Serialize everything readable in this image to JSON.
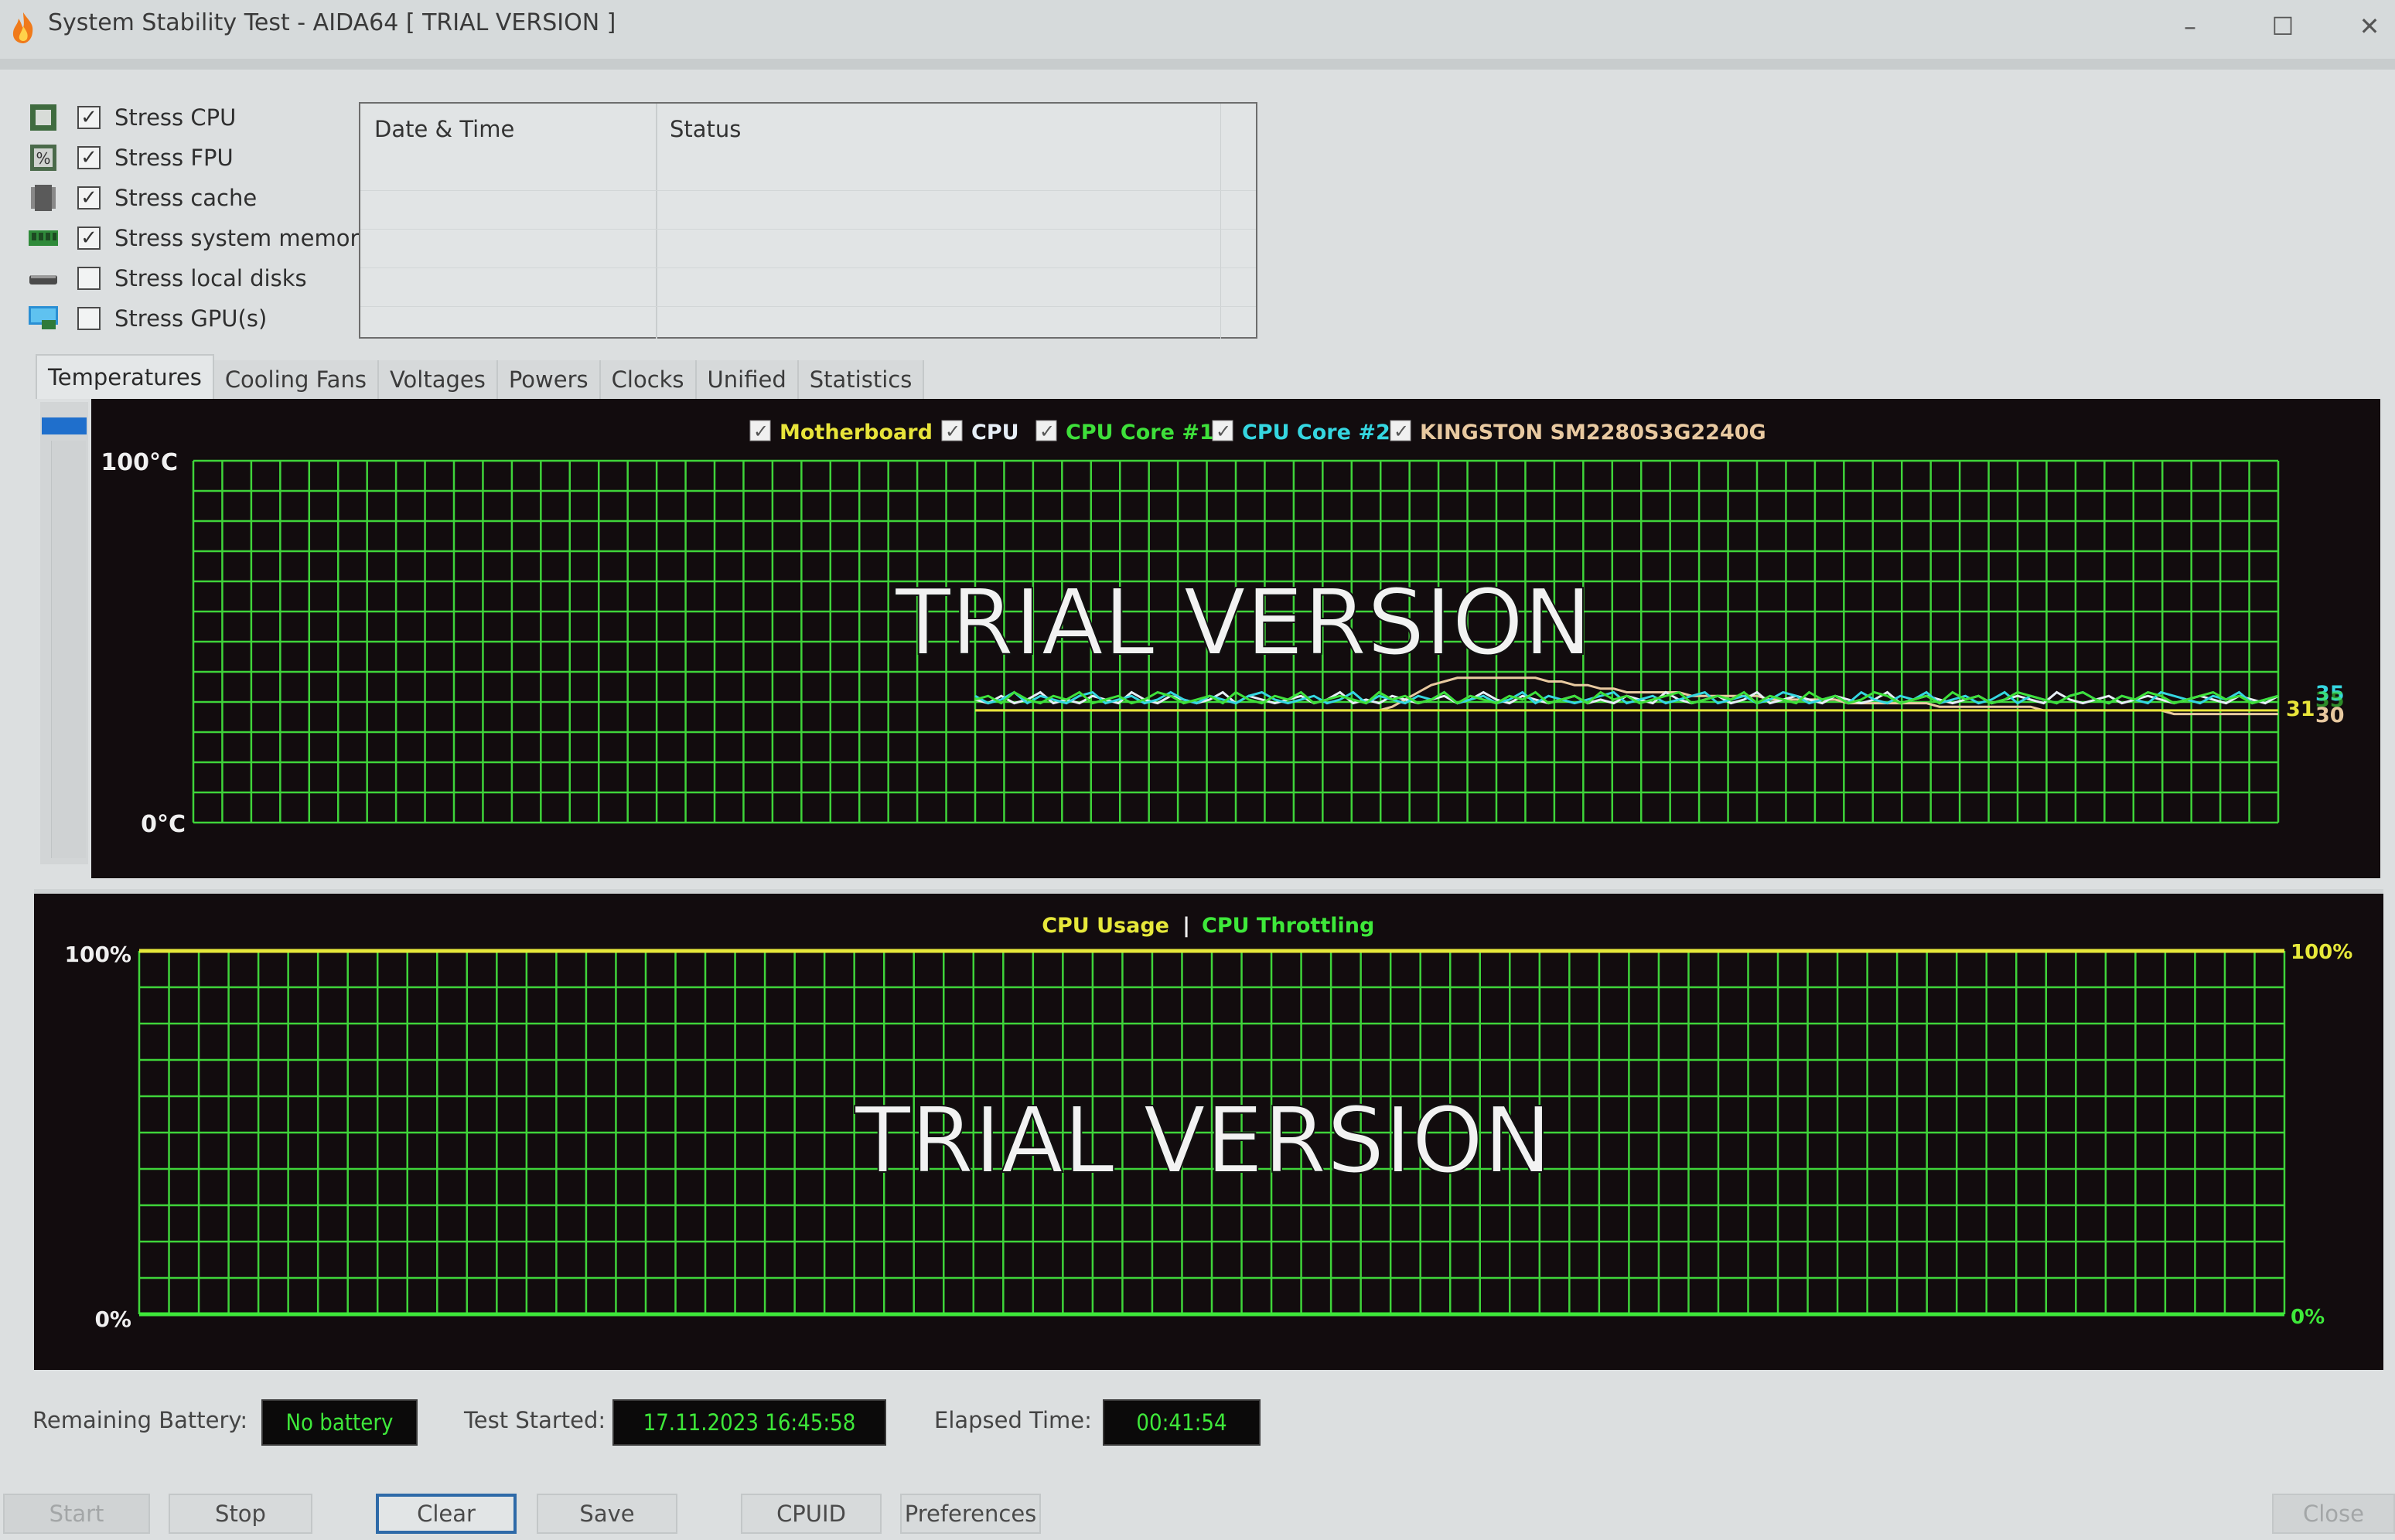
{
  "window": {
    "title": "System Stability Test - AIDA64  [ TRIAL VERSION ]",
    "app_icon": "flame-icon",
    "controls": {
      "minimize": "–",
      "maximize": "☐",
      "close": "✕"
    }
  },
  "stress_options": [
    {
      "label": "Stress CPU",
      "checked": true,
      "icon": "cpu-chip-icon"
    },
    {
      "label": "Stress FPU",
      "checked": true,
      "icon": "fpu-percent-icon"
    },
    {
      "label": "Stress cache",
      "checked": true,
      "icon": "cache-chip-icon"
    },
    {
      "label": "Stress system memory",
      "checked": true,
      "icon": "memory-module-icon"
    },
    {
      "label": "Stress local disks",
      "checked": false,
      "icon": "disk-drive-icon"
    },
    {
      "label": "Stress GPU(s)",
      "checked": false,
      "icon": "gpu-monitor-icon"
    }
  ],
  "status_table": {
    "columns": [
      "Date & Time",
      "Status"
    ],
    "rows": []
  },
  "tabs": [
    {
      "label": "Temperatures",
      "active": true
    },
    {
      "label": "Cooling Fans",
      "active": false
    },
    {
      "label": "Voltages",
      "active": false
    },
    {
      "label": "Powers",
      "active": false
    },
    {
      "label": "Clocks",
      "active": false
    },
    {
      "label": "Unified",
      "active": false
    },
    {
      "label": "Statistics",
      "active": false
    }
  ],
  "watermark": "TRIAL VERSION",
  "colors": {
    "grid": "#3fd43a",
    "motherboard": "#e8e43a",
    "cpu": "#e6eef6",
    "core1": "#3ee03a",
    "core2": "#35d6e0",
    "kingston": "#e8c9a0",
    "usage": "#e6e83a",
    "throttling": "#3ee83a"
  },
  "chart_data": [
    {
      "type": "line",
      "title": "Temperatures",
      "ylabel": "°C",
      "ylim": [
        0,
        100
      ],
      "y_tick_labels": [
        "100°C",
        "0°C"
      ],
      "grid": true,
      "legend_position": "top-center",
      "x": [
        0,
        1,
        2,
        3,
        4,
        5,
        6,
        7,
        8,
        9,
        10,
        11,
        12,
        13,
        14,
        15,
        16,
        17,
        18,
        19,
        20,
        21,
        22,
        23,
        24,
        25,
        26,
        27,
        28,
        29,
        30,
        31,
        32,
        33,
        34,
        35,
        36,
        37,
        38,
        39,
        40,
        41,
        42,
        43,
        44,
        45,
        46,
        47,
        48,
        49,
        50,
        51,
        52,
        53,
        54,
        55,
        56,
        57,
        58,
        59,
        60,
        61,
        62,
        63,
        64,
        65,
        66,
        67,
        68,
        69,
        70,
        71,
        72,
        73,
        74,
        75,
        76,
        77,
        78,
        79,
        80,
        81,
        82,
        83,
        84,
        85,
        86,
        87,
        88,
        89,
        90,
        91,
        92,
        93,
        94,
        95,
        96,
        97,
        98,
        99,
        100
      ],
      "x_start_fraction": 0.375,
      "series": [
        {
          "name": "Motherboard",
          "checked": true,
          "color": "#e8e43a",
          "current": 31,
          "values": [
            31,
            31,
            31,
            31,
            31,
            31,
            31,
            31,
            31,
            31,
            31,
            31,
            31,
            31,
            31,
            31,
            31,
            31,
            31,
            31,
            31,
            31,
            31,
            31,
            31,
            31,
            31,
            31,
            31,
            31,
            31,
            31,
            31,
            31,
            31,
            31,
            31,
            31,
            31,
            31,
            31,
            31,
            31,
            31,
            31,
            31,
            31,
            31,
            31,
            31,
            31,
            31,
            31,
            31,
            31,
            31,
            31,
            31,
            31,
            31,
            31,
            31,
            31,
            31,
            31,
            31,
            31,
            31,
            31,
            31,
            31,
            31,
            31,
            31,
            31,
            31,
            31,
            31,
            31,
            31,
            31,
            31,
            31,
            31,
            31,
            31,
            31,
            31,
            31,
            31,
            31,
            31,
            31,
            31,
            31,
            31,
            31,
            31,
            31,
            31,
            31
          ]
        },
        {
          "name": "CPU",
          "checked": true,
          "color": "#e6eef6",
          "current": null,
          "values": [
            34,
            33,
            35,
            33,
            34,
            36,
            33,
            34,
            33,
            35,
            34,
            33,
            36,
            34,
            33,
            35,
            34,
            33,
            34,
            36,
            33,
            35,
            34,
            33,
            34,
            35,
            33,
            34,
            36,
            33,
            34,
            33,
            35,
            34,
            33,
            34,
            35,
            33,
            34,
            36,
            34,
            33,
            35,
            34,
            33,
            34,
            35,
            33,
            34,
            33,
            35,
            34,
            33,
            36,
            34,
            33,
            34,
            35,
            33,
            34,
            36,
            33,
            34,
            35,
            34,
            33,
            35,
            34,
            33,
            34,
            36,
            33,
            34,
            35,
            34,
            33,
            34,
            35,
            33,
            34,
            35,
            34,
            33,
            36,
            34,
            33,
            34,
            35,
            33,
            34,
            35,
            34,
            33,
            34,
            35,
            34,
            33,
            35,
            34,
            33,
            35
          ]
        },
        {
          "name": "CPU Core #1",
          "checked": true,
          "color": "#3ee03a",
          "current": 35,
          "values": [
            34,
            35,
            33,
            36,
            34,
            33,
            35,
            34,
            36,
            33,
            34,
            35,
            33,
            34,
            36,
            35,
            33,
            34,
            35,
            33,
            36,
            34,
            33,
            35,
            34,
            36,
            33,
            34,
            35,
            34,
            33,
            36,
            34,
            35,
            33,
            34,
            36,
            33,
            35,
            34,
            33,
            35,
            34,
            36,
            33,
            34,
            35,
            33,
            36,
            34,
            35,
            33,
            34,
            35,
            36,
            33,
            34,
            35,
            34,
            36,
            33,
            35,
            34,
            33,
            36,
            34,
            35,
            33,
            34,
            36,
            35,
            33,
            34,
            35,
            33,
            36,
            34,
            35,
            33,
            34,
            36,
            35,
            34,
            33,
            35,
            36,
            34,
            33,
            35,
            34,
            36,
            35,
            33,
            34,
            35,
            36,
            34,
            35,
            33,
            34,
            35
          ]
        },
        {
          "name": "CPU Core #2",
          "checked": true,
          "color": "#35d6e0",
          "current": 35,
          "values": [
            35,
            33,
            34,
            36,
            33,
            35,
            34,
            33,
            35,
            36,
            33,
            34,
            35,
            33,
            34,
            36,
            34,
            33,
            35,
            34,
            33,
            35,
            36,
            34,
            33,
            34,
            35,
            33,
            34,
            36,
            33,
            35,
            34,
            33,
            35,
            34,
            36,
            33,
            34,
            35,
            33,
            34,
            36,
            33,
            35,
            34,
            33,
            34,
            35,
            36,
            33,
            34,
            35,
            33,
            34,
            35,
            36,
            33,
            34,
            35,
            33,
            34,
            36,
            35,
            33,
            34,
            35,
            33,
            36,
            34,
            33,
            35,
            34,
            36,
            33,
            34,
            35,
            33,
            34,
            36,
            33,
            35,
            34,
            33,
            35,
            36,
            34,
            33,
            35,
            34,
            33,
            36,
            35,
            34,
            33,
            35,
            34,
            36,
            33,
            34,
            35
          ]
        },
        {
          "name": "KINGSTON SM2280S3G2240G",
          "checked": true,
          "color": "#e8c9a0",
          "current": 30,
          "values": [
            31,
            31,
            31,
            31,
            31,
            31,
            31,
            31,
            31,
            31,
            31,
            31,
            31,
            31,
            31,
            31,
            31,
            31,
            31,
            31,
            31,
            31,
            31,
            31,
            31,
            31,
            31,
            31,
            31,
            31,
            31,
            31,
            32,
            34,
            36,
            38,
            39,
            40,
            40,
            40,
            40,
            40,
            40,
            40,
            39,
            39,
            38,
            38,
            37,
            37,
            36,
            36,
            36,
            36,
            36,
            35,
            35,
            35,
            35,
            35,
            35,
            34,
            34,
            34,
            34,
            34,
            34,
            33,
            33,
            33,
            33,
            33,
            33,
            33,
            32,
            32,
            32,
            32,
            32,
            32,
            32,
            32,
            31,
            31,
            31,
            31,
            31,
            31,
            31,
            31,
            31,
            31,
            30,
            30,
            30,
            30,
            30,
            30,
            30,
            30,
            30
          ]
        }
      ],
      "current_value_labels": [
        {
          "series": "Motherboard",
          "text": "31"
        },
        {
          "series": "CPU Core #2",
          "text": "35"
        },
        {
          "series": "CPU Core #1",
          "text": "35"
        },
        {
          "series": "KINGSTON SM2280S3G2240G",
          "text": "30"
        }
      ]
    },
    {
      "type": "line",
      "title": "CPU Usage | CPU Throttling",
      "ylabel": "%",
      "ylim": [
        0,
        100
      ],
      "y_tick_labels": [
        "100%",
        "0%"
      ],
      "grid": true,
      "legend_position": "top-center",
      "series": [
        {
          "name": "CPU Usage",
          "color": "#e6e83a",
          "values": [
            100,
            100
          ],
          "current_label": "100%"
        },
        {
          "name": "CPU Throttling",
          "color": "#3ee83a",
          "values": [
            0,
            0
          ],
          "current_label": "0%"
        }
      ],
      "separator": "|"
    }
  ],
  "status_bar": {
    "battery_label": "Remaining Battery:",
    "battery_value": "No battery",
    "started_label": "Test Started:",
    "started_value": "17.11.2023 16:45:58",
    "elapsed_label": "Elapsed Time:",
    "elapsed_value": "00:41:54"
  },
  "buttons": {
    "start": {
      "label": "Start",
      "enabled": false
    },
    "stop": {
      "label": "Stop",
      "enabled": true
    },
    "clear": {
      "label": "Clear",
      "enabled": true,
      "focused": true
    },
    "save": {
      "label": "Save",
      "enabled": true
    },
    "cpuid": {
      "label": "CPUID",
      "enabled": true
    },
    "preferences": {
      "label": "Preferences",
      "enabled": true
    },
    "close": {
      "label": "Close",
      "enabled": false
    }
  }
}
